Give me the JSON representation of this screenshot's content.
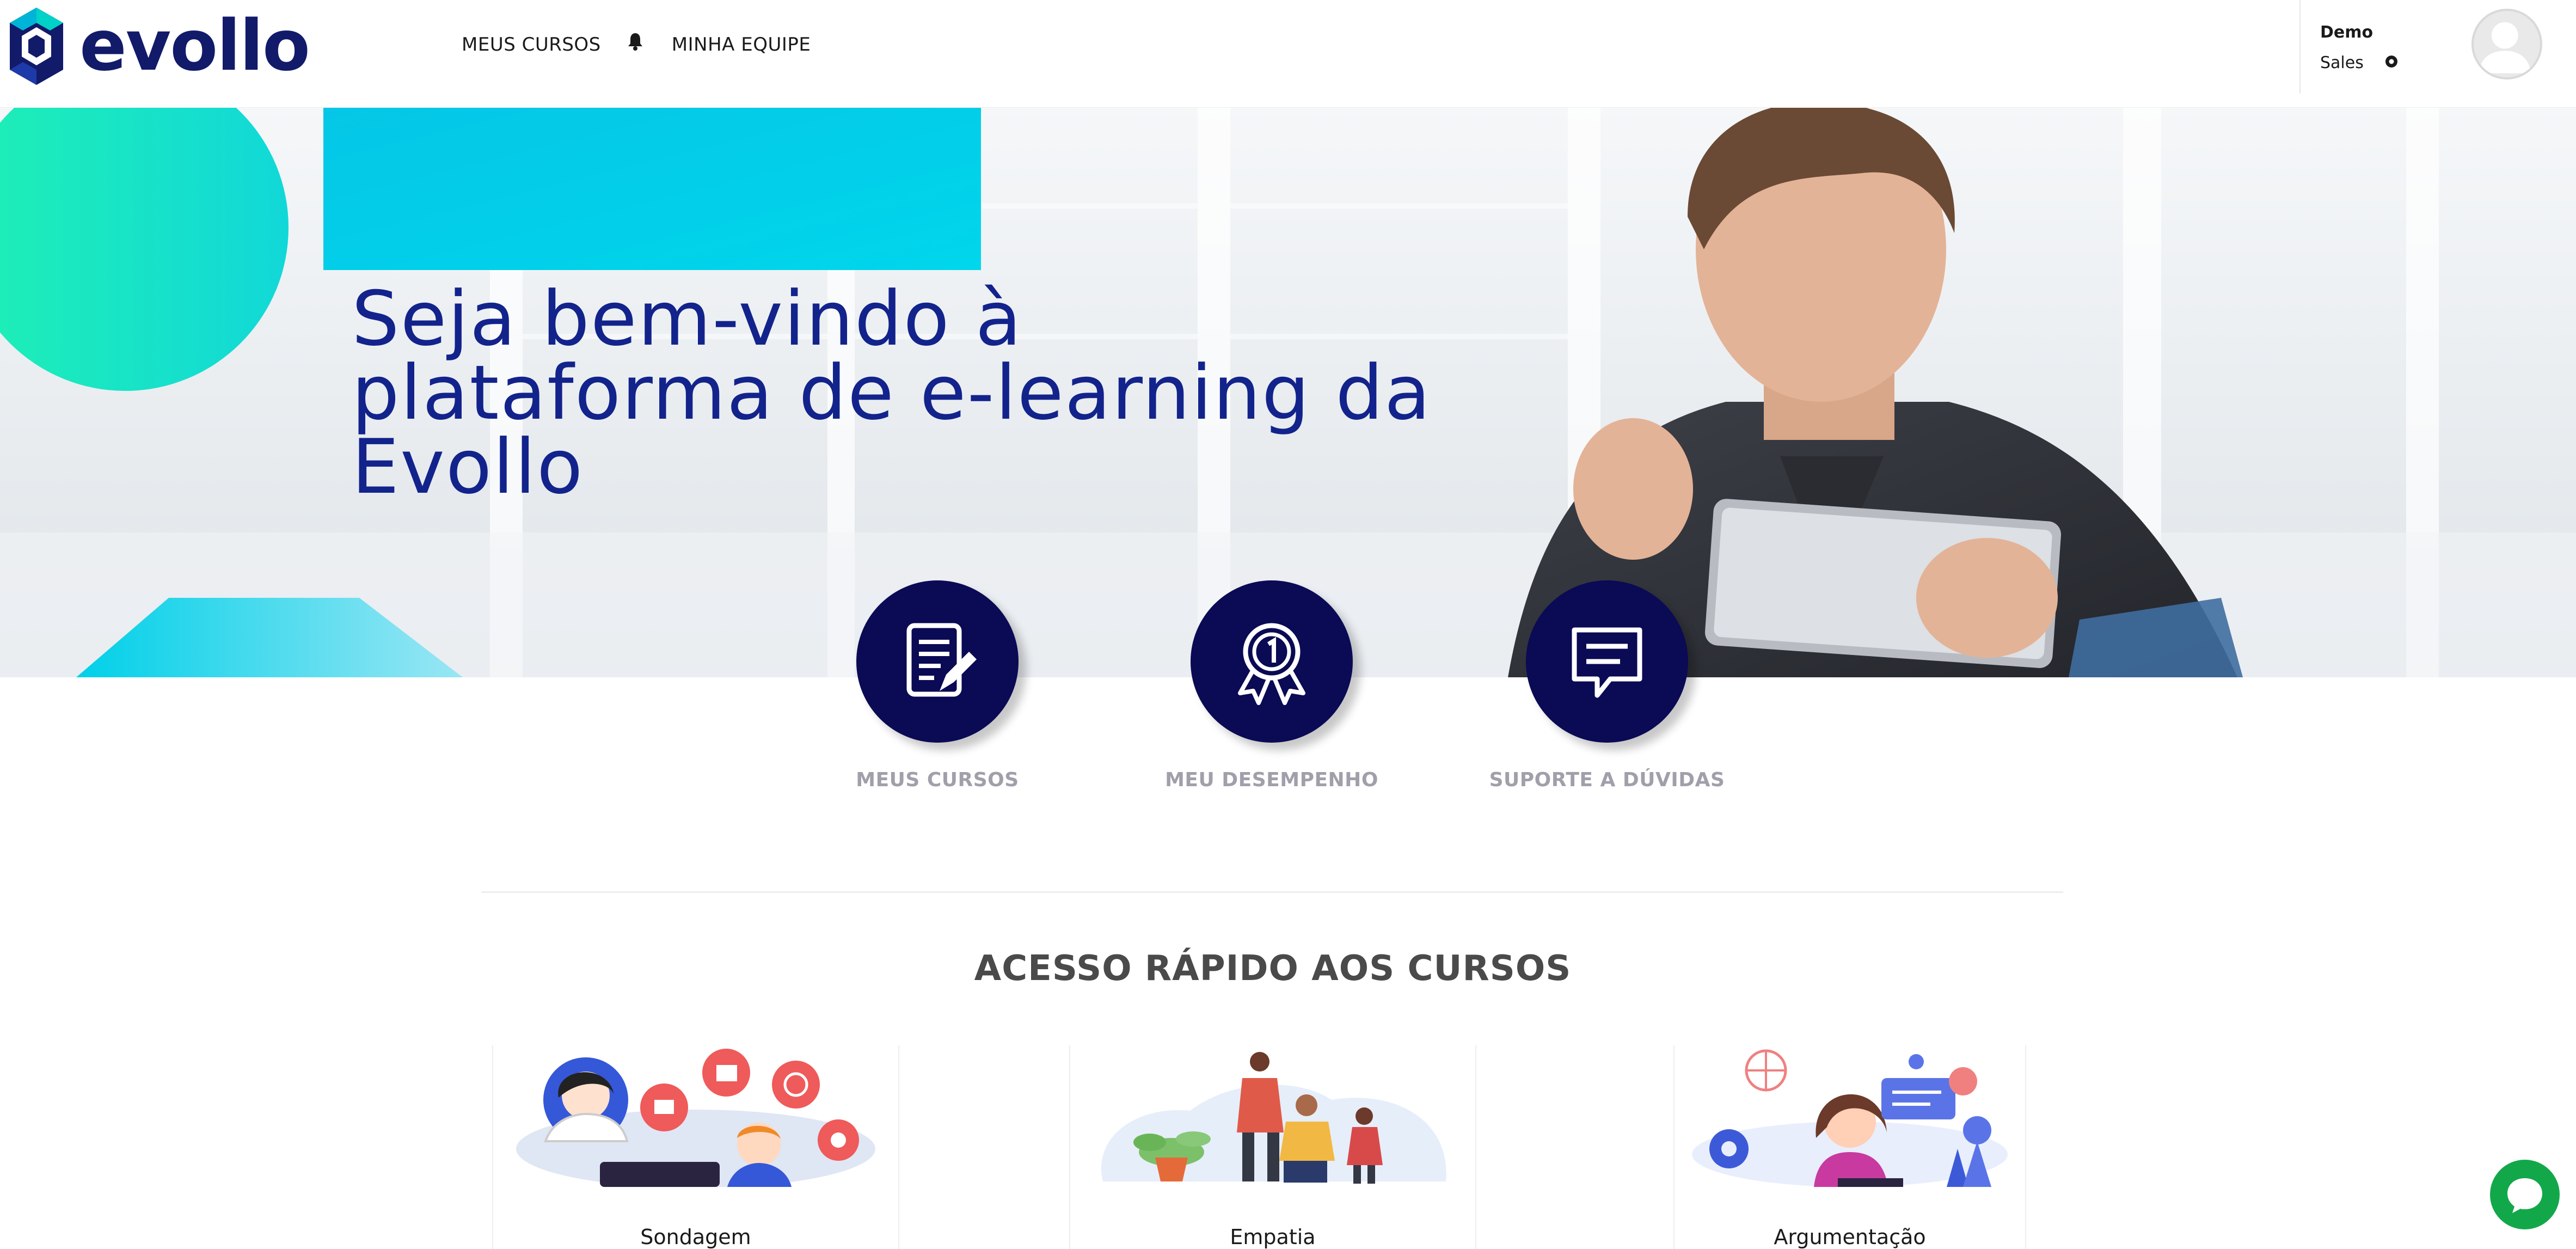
{
  "brand": {
    "name": "evollo",
    "color": "#121a6a"
  },
  "nav": {
    "items": [
      {
        "label": "MEUS CURSOS"
      },
      {
        "label": "MINHA EQUIPE"
      }
    ],
    "bell_icon": "bell-icon"
  },
  "user": {
    "name": "Demo",
    "role": "Sales",
    "settings_icon": "gear-icon"
  },
  "hero": {
    "title": "Seja bem-vindo à plataforma de e-learning da Evollo",
    "title_color": "#13238c",
    "accent_cyan": "#00c8e6",
    "accent_green": "#1ff0b4"
  },
  "features": [
    {
      "label": "MEUS CURSOS",
      "icon": "document-edit-icon"
    },
    {
      "label": "MEU DESEMPENHO",
      "icon": "award-medal-icon"
    },
    {
      "label": "SUPORTE A DÚVIDAS",
      "icon": "chat-message-icon"
    }
  ],
  "section": {
    "title": "ACESSO RÁPIDO AOS CURSOS"
  },
  "courses": [
    {
      "label": "Sondagem"
    },
    {
      "label": "Empatia"
    },
    {
      "label": "Argumentação"
    }
  ],
  "chat": {
    "icon": "chat-bubble-icon",
    "color": "#12a84a"
  }
}
